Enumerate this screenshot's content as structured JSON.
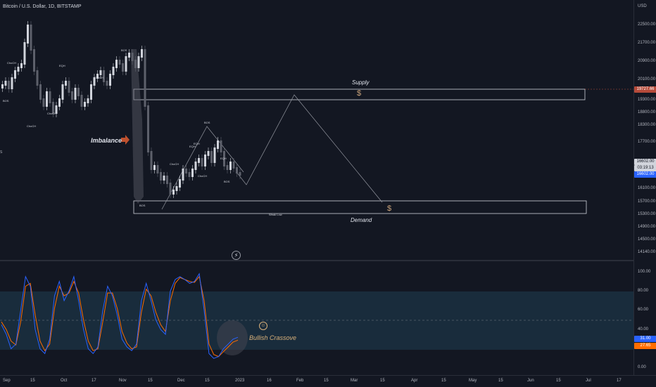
{
  "header": {
    "symbol": "Bitcoin / U.S. Dollar, 1D, BITSTAMP"
  },
  "price_axis": {
    "currency": "USD",
    "ticks": [
      "22500.00",
      "21700.00",
      "20900.00",
      "20100.00",
      "19300.00",
      "18800.00",
      "18300.00",
      "17700.00",
      "16600.00",
      "16100.00",
      "15700.00",
      "15300.00",
      "14900.00",
      "14500.00",
      "14140.00"
    ],
    "badges": {
      "supply_price": "19727.66",
      "last_price": "16602.00",
      "last_price_timer": "03:19:13",
      "last_close": "16602.00"
    }
  },
  "oscillator_axis": {
    "ticks": [
      "100.00",
      "80.00",
      "60.00",
      "40.00",
      "20.00",
      "0.00"
    ],
    "badges": {
      "k": "31.00",
      "d": "27.65"
    }
  },
  "time_axis": {
    "ticks": [
      "Sep",
      "15",
      "Oct",
      "17",
      "Nov",
      "15",
      "Dec",
      "15",
      "2023",
      "16",
      "Feb",
      "15",
      "Mar",
      "15",
      "Apr",
      "15",
      "May",
      "15",
      "Jun",
      "15",
      "Jul",
      "17"
    ]
  },
  "annotations": {
    "supply_label": "Supply",
    "demand_label": "Demand",
    "imbalance_label": "Imbalance",
    "bullish_label": "Bullish Crassove",
    "dollar_sign": "$",
    "weak_low": "Weak Low",
    "choch_labels": [
      "ChoCH",
      "ChoCH",
      "ChoCH",
      "ChoCH",
      "ChoCH",
      "ChoCH"
    ],
    "eqh_labels": [
      "EQH",
      "EQH",
      "EQH",
      "EQH"
    ],
    "bos_labels": [
      "BOS",
      "BOS",
      "BOS",
      "BOS",
      "BOS"
    ],
    "left_edge_text": "S"
  },
  "colors": {
    "background": "#131722",
    "up_candle": "#d1d4dc",
    "down_candle": "#5d606b",
    "stoch_k": "#2962ff",
    "stoch_d": "#ff6d00",
    "band_fill": "#1e3a4f",
    "supply_badge": "#b54a3a",
    "price_badge": "#2a2e39"
  },
  "oscillator_data": {
    "k": [
      45,
      35,
      20,
      25,
      60,
      95,
      85,
      40,
      20,
      15,
      30,
      75,
      90,
      70,
      80,
      95,
      70,
      40,
      20,
      15,
      22,
      60,
      85,
      75,
      55,
      30,
      22,
      18,
      25,
      70,
      88,
      70,
      50,
      40,
      35,
      80,
      92,
      95,
      92,
      88,
      90,
      98,
      60,
      15,
      10,
      12,
      20,
      25,
      30,
      32
    ],
    "d": [
      48,
      40,
      28,
      24,
      48,
      85,
      88,
      55,
      28,
      18,
      25,
      62,
      85,
      75,
      78,
      90,
      78,
      50,
      28,
      18,
      20,
      48,
      78,
      78,
      62,
      38,
      26,
      20,
      22,
      58,
      82,
      75,
      58,
      45,
      38,
      70,
      88,
      94,
      92,
      90,
      89,
      95,
      70,
      25,
      14,
      12,
      17,
      22,
      27,
      29
    ]
  }
}
